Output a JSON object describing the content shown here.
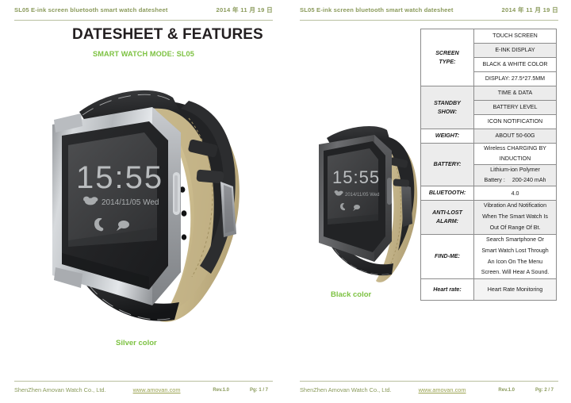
{
  "document": {
    "header_title": "SL05 E-ink screen bluetooth smart watch datesheet",
    "header_date": "2014 年 11 月 19 日",
    "footer_company": "ShenZhen Amovan Watch Co., Ltd.",
    "footer_link": "www.amovan.com",
    "footer_rev": "Rev.1.0"
  },
  "page_left": {
    "title": "DATESHEET & FEATURES",
    "subtitle": "SMART WATCH MODE: SL05",
    "watch_caption": "Silver color",
    "watch_display": {
      "time": "15:55",
      "date": "2014/11/05  Wed",
      "weather_icon": "cloud-icon",
      "call_icon": "phone-icon",
      "message_icon": "message-icon"
    },
    "footer_page": "Pg: 1 / 7"
  },
  "page_right": {
    "watch_caption": "Black color",
    "watch_display": {
      "time": "15:55",
      "date": "2014/11/05 Wed",
      "weather_icon": "cloud-icon",
      "call_icon": "phone-icon",
      "message_icon": "message-icon"
    },
    "footer_page": "Pg: 2 / 7"
  },
  "spec_table": {
    "rows": [
      {
        "label": "SCREEN TYPE:",
        "label_line1": "SCREEN",
        "label_line2": "TYPE:",
        "values": [
          "TOUCH SCREEN",
          "E-INK DISPLAY",
          "BLACK & WHITE COLOR",
          "DISPLAY: 27.5*27.5MM"
        ]
      },
      {
        "label": "STANDBY SHOW:",
        "label_line1": "STANDBY",
        "label_line2": "SHOW:",
        "values": [
          "TIME & DATA",
          "BATTERY LEVEL",
          "ICON NOTIFICATION"
        ]
      },
      {
        "label": "WEIGHT:",
        "label_line1": "WEIGHT:",
        "label_line2": "",
        "values": [
          "ABOUT 50-60G"
        ]
      },
      {
        "label": "BATTERY:",
        "label_line1": "BATTERY:",
        "label_line2": "",
        "values": [
          "Wireless CHARGING BY INDUCTION",
          "Lithium-ion Polymer Battery :    200-240 mAh"
        ],
        "value_parts": {
          "cell1_line1": "Wireless CHARGING BY",
          "cell1_line2": "INDUCTION",
          "cell2_line1": "Lithium-ion Polymer",
          "cell2_line2a": "Battery :",
          "cell2_line2b": "200-240 mAh"
        }
      },
      {
        "label": "BLUETOOTH:",
        "label_line1": "BLUETOOTH:",
        "label_line2": "",
        "values": [
          "4.0"
        ]
      },
      {
        "label": "ANTI-LOST ALARM:",
        "label_line1": "ANTI-LOST",
        "label_line2": "ALARM:",
        "values": [
          "Vibration And Notification When The Smart Watch Is Out Of Range Of Bt."
        ],
        "value_lines": [
          "Vibration And Notification",
          "When The Smart Watch Is",
          "Out Of Range Of Bt."
        ]
      },
      {
        "label": "FIND-ME:",
        "label_line1": "FIND-ME:",
        "label_line2": "",
        "values": [
          "Search Smartphone Or Smart Watch Lost Through An Icon On The Menu Screen. Will Hear A Sound."
        ],
        "value_lines": [
          "Search Smartphone Or",
          "Smart Watch Lost Through",
          "An Icon On The Menu",
          "Screen. Will Hear A Sound."
        ]
      },
      {
        "label": "Heart rate:",
        "label_line1": "Heart rate:",
        "label_line2": "",
        "values": [
          "Heart Rate Monitoring"
        ]
      }
    ]
  },
  "colors": {
    "brand_green": "#7dc242",
    "header_olive": "#8a9a5b",
    "link_olive": "#9aa24f",
    "title_black": "#231f20",
    "table_border": "#8c8c8c",
    "table_shade": "#ececec"
  }
}
